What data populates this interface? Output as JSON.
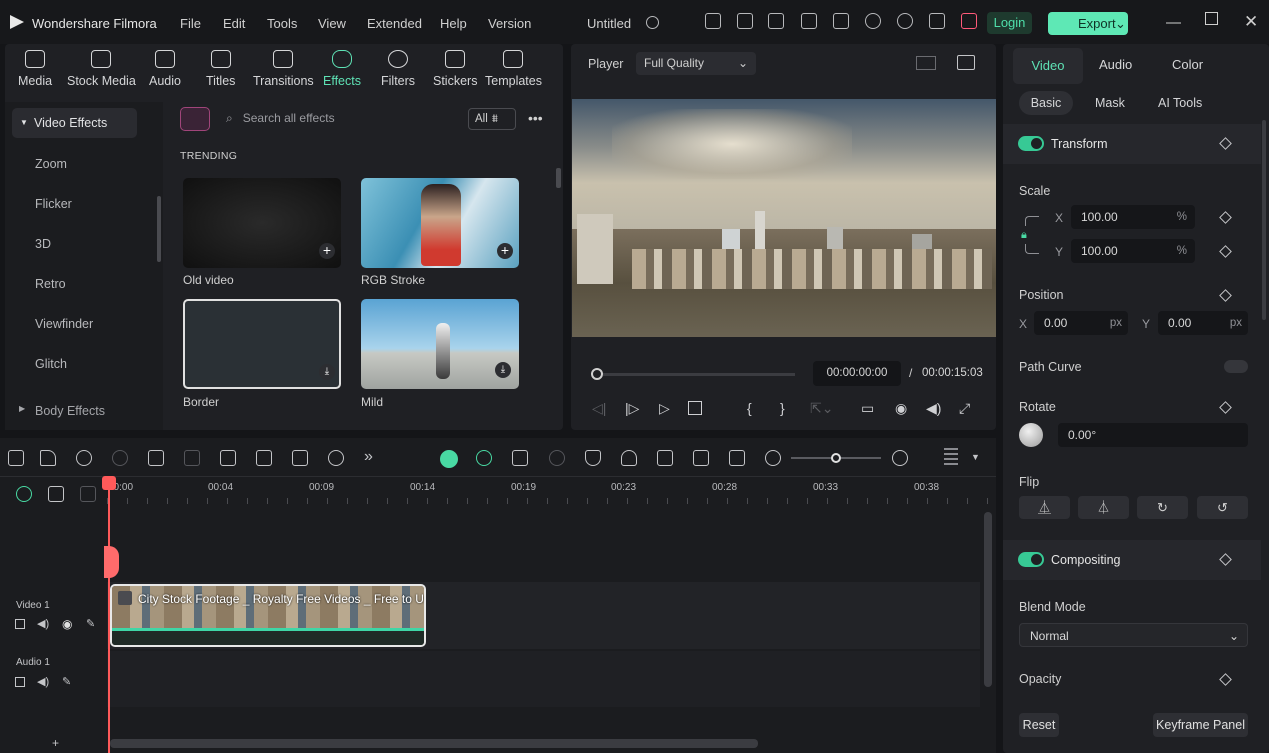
{
  "app": {
    "name": "Wondershare Filmora",
    "project": "Untitled"
  },
  "menu": [
    "File",
    "Edit",
    "Tools",
    "View",
    "Extended",
    "Help",
    "Version"
  ],
  "header": {
    "login": "Login",
    "export": "Export"
  },
  "tabs": [
    "Media",
    "Stock Media",
    "Audio",
    "Titles",
    "Transitions",
    "Effects",
    "Filters",
    "Stickers",
    "Templates"
  ],
  "effects": {
    "categories": [
      "Video Effects",
      "Zoom",
      "Flicker",
      "3D",
      "Retro",
      "Viewfinder",
      "Glitch",
      "Body Effects"
    ],
    "search_placeholder": "Search all effects",
    "filter": "All",
    "section": "TRENDING",
    "items": [
      "Old video",
      "RGB Stroke",
      "Border",
      "Mild"
    ]
  },
  "player": {
    "label": "Player",
    "quality": "Full Quality",
    "current_time": "00:00:00:00",
    "sep": "/",
    "total_time": "00:00:15:03"
  },
  "inspector": {
    "tabs": [
      "Video",
      "Audio",
      "Color"
    ],
    "subtabs": [
      "Basic",
      "Mask",
      "AI Tools"
    ],
    "transform": "Transform",
    "scale": {
      "label": "Scale",
      "x": "100.00",
      "y": "100.00",
      "unit": "%"
    },
    "position": {
      "label": "Position",
      "x": "0.00",
      "y": "0.00",
      "unit": "px"
    },
    "path_curve": "Path Curve",
    "rotate": {
      "label": "Rotate",
      "value": "0.00°"
    },
    "flip": "Flip",
    "compositing": "Compositing",
    "blend_mode": {
      "label": "Blend Mode",
      "value": "Normal"
    },
    "opacity": "Opacity",
    "reset": "Reset",
    "keyframe": "Keyframe Panel",
    "axis_x": "X",
    "axis_y": "Y"
  },
  "timeline": {
    "ticks": [
      "00:00",
      "00:04",
      "00:09",
      "00:14",
      "00:19",
      "00:23",
      "00:28",
      "00:33",
      "00:38"
    ],
    "tracks": [
      "Video 1",
      "Audio 1"
    ],
    "clip_title": "City Stock Footage _ Royalty Free Videos _ Free to Us..."
  }
}
